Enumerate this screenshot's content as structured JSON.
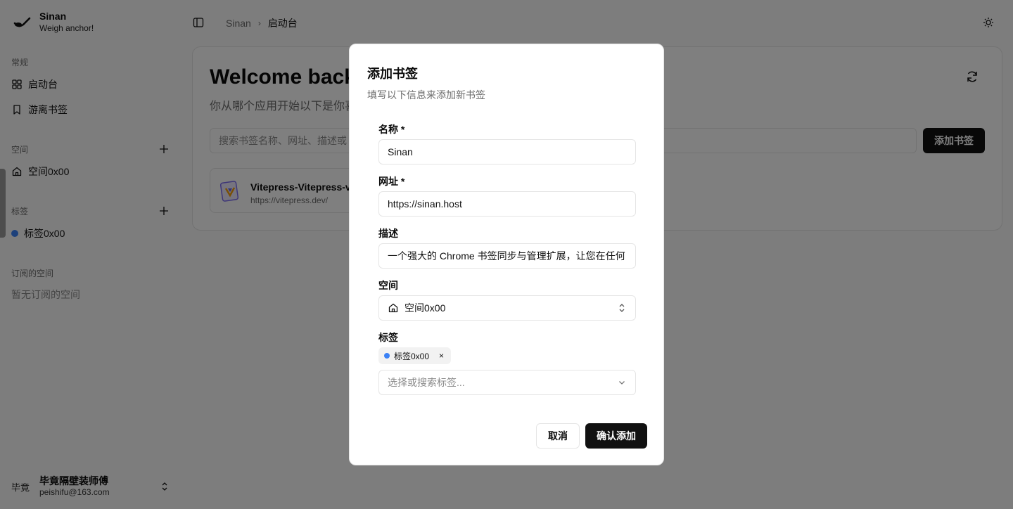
{
  "sidebar": {
    "brand_name": "Sinan",
    "brand_tagline": "Weigh anchor!",
    "section_general": "常规",
    "nav_launchpad": "启动台",
    "nav_orphan_bookmarks": "游离书签",
    "section_spaces": "空间",
    "space_item": "空间0x00",
    "section_tags": "标签",
    "tag_item": "标签0x00",
    "tag_color": "#3b82f6",
    "section_subscribed": "订阅的空间",
    "subscribed_empty": "暂无订阅的空间",
    "user": {
      "avatar_text": "毕竟",
      "name": "毕竟隔壁装师傅",
      "email": "peishifu@163.com"
    }
  },
  "header": {
    "breadcrumb": [
      "Sinan",
      "启动台"
    ]
  },
  "main": {
    "welcome": "Welcome back",
    "subtitle": "你从哪个应用开始以下是你喜",
    "search_placeholder": "搜索书签名称、网址、描述或",
    "add_button": "添加书签",
    "card": {
      "title": "Vitepress-Vitepress-v",
      "url": "https://vitepress.dev/"
    }
  },
  "dialog": {
    "title": "添加书签",
    "description": "填写以下信息来添加新书签",
    "name_label": "名称 *",
    "name_value": "Sinan",
    "url_label": "网址 *",
    "url_value": "https://sinan.host",
    "desc_label": "描述",
    "desc_value": "一个强大的 Chrome 书签同步与管理扩展，让您在任何",
    "space_label": "空间",
    "space_value": "空间0x00",
    "tags_label": "标签",
    "selected_tag": "标签0x00",
    "selected_tag_remove": "×",
    "tag_placeholder": "选择或搜索标签...",
    "cancel": "取消",
    "confirm": "确认添加"
  },
  "colors": {
    "accent": "#111111",
    "overlay": "rgba(0,0,0,0.5)",
    "tag_dot": "#3b82f6"
  }
}
